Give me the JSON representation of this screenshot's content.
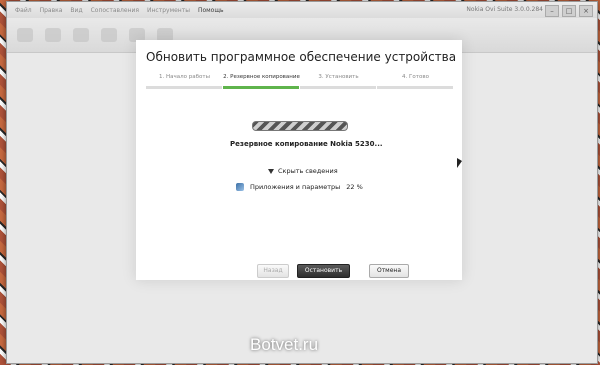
{
  "window": {
    "title": "Nokia Ovi Suite 3.0.0.284",
    "menu": [
      "Файл",
      "Правка",
      "Вид",
      "Сопоставления",
      "Инструменты",
      "Помощь"
    ],
    "window_buttons": [
      "–",
      "□",
      "×"
    ]
  },
  "dialog": {
    "title": "Обновить программное обеспечение устройства",
    "steps": [
      {
        "label": "1. Начало работы",
        "active": false
      },
      {
        "label": "2. Резервное копирование",
        "active": true
      },
      {
        "label": "3. Установить",
        "active": false
      },
      {
        "label": "4. Готово",
        "active": false
      }
    ],
    "status": "Резервное копирование Nokia 5230...",
    "toggle_details": "Скрыть сведения",
    "detail_label": "Приложения и параметры",
    "detail_value": "22 %"
  },
  "buttons": {
    "back": "Назад",
    "stop": "Остановить",
    "cancel": "Отмена"
  },
  "watermark": "Botvet.ru",
  "colors": {
    "accent": "#5fb44c",
    "primary_button": "#3a3a3a"
  }
}
